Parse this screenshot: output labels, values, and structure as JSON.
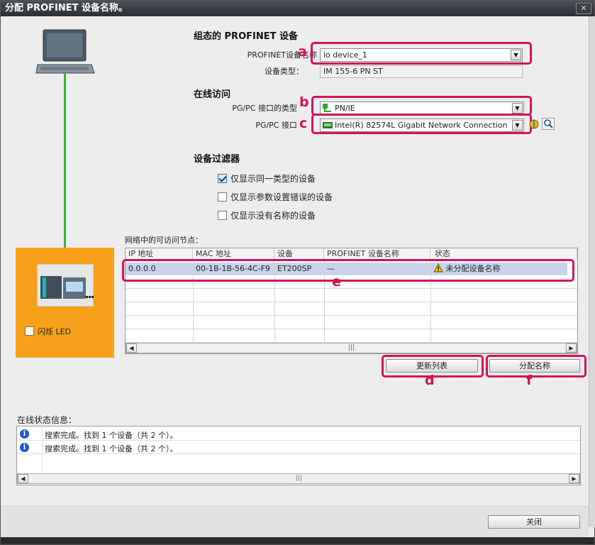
{
  "window": {
    "title": "分配 PROFINET 设备名称。"
  },
  "configured": {
    "heading": "组态的 PROFINET 设备",
    "device_name_label": "PROFINET设备名称",
    "device_name_value": "io device_1",
    "device_type_label": "设备类型：",
    "device_type_value": "IM 155-6 PN ST"
  },
  "online": {
    "heading": "在线访问",
    "interface_type_label": "PG/PC 接口的类型",
    "interface_type_value": "PN/IE",
    "interface_label": "PG/PC 接口",
    "interface_value": "Intel(R) 82574L Gigabit Network Connection"
  },
  "filter": {
    "heading": "设备过滤器",
    "options": [
      {
        "label": "仅显示同一类型的设备",
        "checked": true
      },
      {
        "label": "仅显示参数设置错误的设备",
        "checked": false
      },
      {
        "label": "仅显示没有名称的设备",
        "checked": false
      }
    ]
  },
  "device_panel": {
    "flash_led_label": "闪烁 LED"
  },
  "nodes": {
    "heading": "网络中的可访问节点：",
    "columns": [
      "IP 地址",
      "MAC 地址",
      "设备",
      "PROFINET 设备名称",
      "状态"
    ],
    "rows": [
      {
        "ip": "0.0.0.0",
        "mac": "00-1B-1B-56-4C-F9",
        "device": "ET200SP",
        "name": "—",
        "status": "未分配设备名称"
      }
    ]
  },
  "buttons": {
    "update_list": "更新列表",
    "assign_name": "分配名称",
    "close": "关闭"
  },
  "annotations": {
    "a": "a",
    "b": "b",
    "c": "c",
    "d": "d",
    "e": "e",
    "f": "f"
  },
  "status_info": {
    "heading": "在线状态信息：",
    "messages": [
      "搜索完成。找到 1 个设备（共 2 个）。",
      "搜索完成。找到 1 个设备（共 2 个）。"
    ]
  },
  "colors": {
    "highlight": "#d4145a",
    "panel_orange": "#f7a01a",
    "link_green": "#2fb62f",
    "selected_row": "#c7d4ec"
  },
  "icons": [
    "laptop-icon",
    "network-icon",
    "device-icon",
    "warning-icon",
    "info-icon",
    "search-icon",
    "properties-icon"
  ]
}
